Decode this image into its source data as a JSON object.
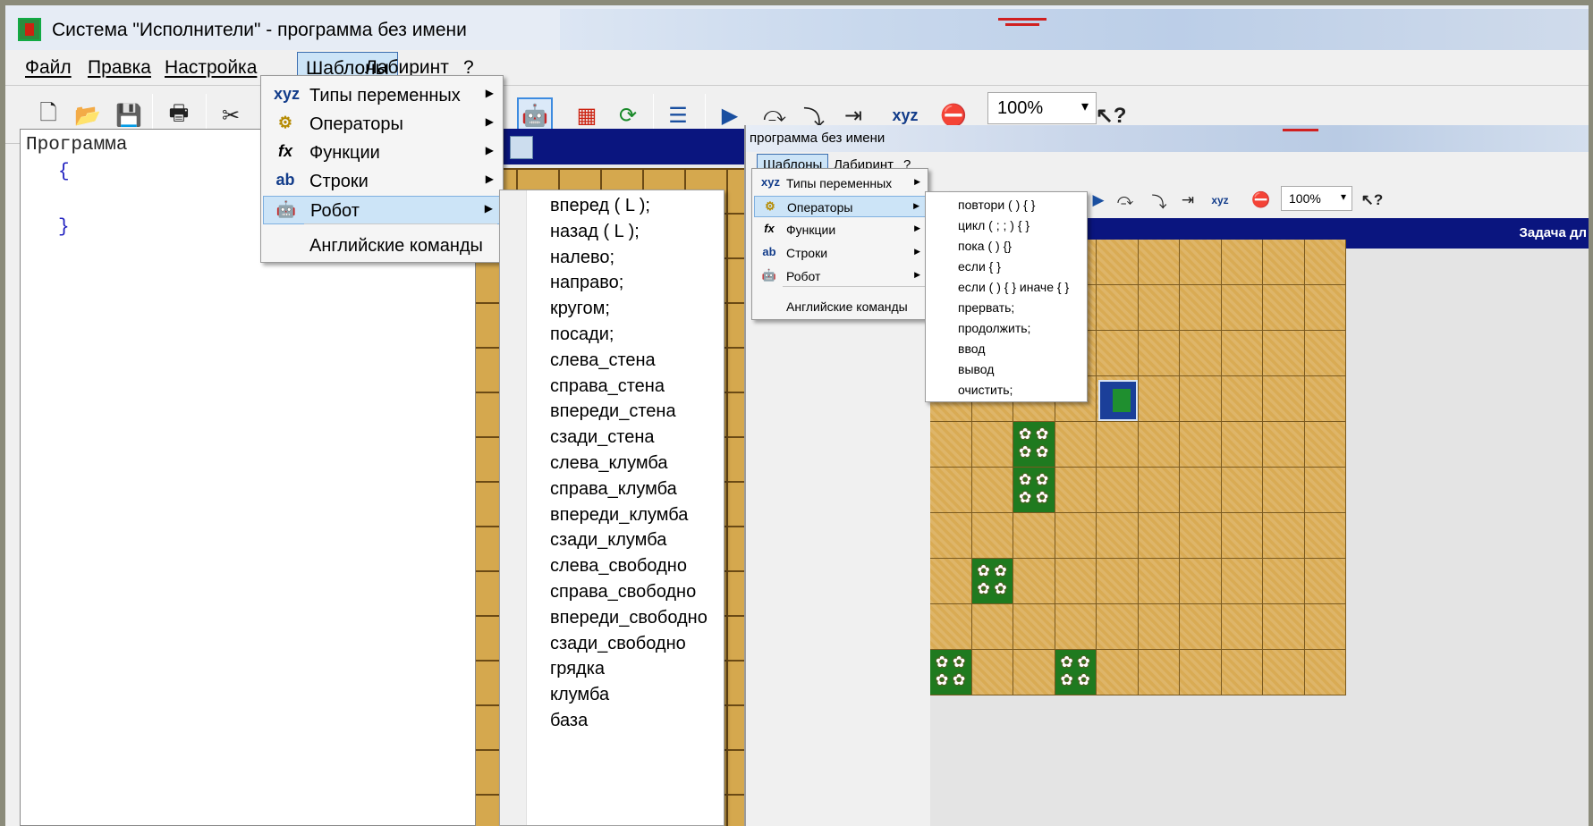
{
  "window": {
    "title": "Система \"Исполнители\" - программа без имени"
  },
  "menu": {
    "file": "Файл",
    "edit": "Правка",
    "settings": "Настройка",
    "templates": "Шаблоны",
    "labyrinth": "Лабиринт",
    "help": "?"
  },
  "toolbar": {
    "zoom": "100%"
  },
  "editor": {
    "title": "Программа",
    "brace_open": "{",
    "brace_close": "}"
  },
  "templates_menu": {
    "items": [
      {
        "icon": "variable-types-icon",
        "label": "Типы переменных",
        "submenu": true
      },
      {
        "icon": "operators-gear-icon",
        "label": "Операторы",
        "submenu": true
      },
      {
        "icon": "function-icon",
        "label": "Функции",
        "submenu": true
      },
      {
        "icon": "strings-ab-icon",
        "label": "Строки",
        "submenu": true
      },
      {
        "icon": "robot-icon",
        "label": "Робот",
        "submenu": true,
        "highlighted": true
      }
    ],
    "english_commands": "Английские команды"
  },
  "robot_commands": [
    "вперед ( L );",
    "назад ( L );",
    "налево;",
    "направо;",
    "кругом;",
    "посади;",
    "слева_стена",
    "справа_стена",
    "впереди_стена",
    "сзади_стена",
    "слева_клумба",
    "справа_клумба",
    "впереди_клумба",
    "сзади_клумба",
    "слева_свободно",
    "справа_свободно",
    "впереди_свободно",
    "сзади_свободно",
    "грядка",
    "клумба",
    "база"
  ],
  "inset": {
    "title": "программа без имени",
    "menu_templates": "Шаблоны",
    "menu_labyrinth": "Лабиринт",
    "menu_help": "?",
    "zoom": "100%",
    "task_label": "Задача дл",
    "templates_menu": {
      "items": [
        {
          "label": "Типы переменных"
        },
        {
          "label": "Операторы",
          "highlighted": true
        },
        {
          "label": "Функции"
        },
        {
          "label": "Строки"
        },
        {
          "label": "Робот"
        }
      ],
      "english_commands": "Английские команды"
    },
    "operators": [
      "повтори ( ) { }",
      "цикл ( ; ; ) { }",
      "пока ( ) {}",
      "если { }",
      "если ( ) { } иначе { }",
      "прервать;",
      "продолжить;",
      "ввод",
      "вывод",
      "очистить;"
    ]
  },
  "colors": {
    "highlight": "#cce4f7",
    "panel_blue": "#0a157f",
    "field": "#d9ab54",
    "flowerbed": "#1f7a1f"
  }
}
